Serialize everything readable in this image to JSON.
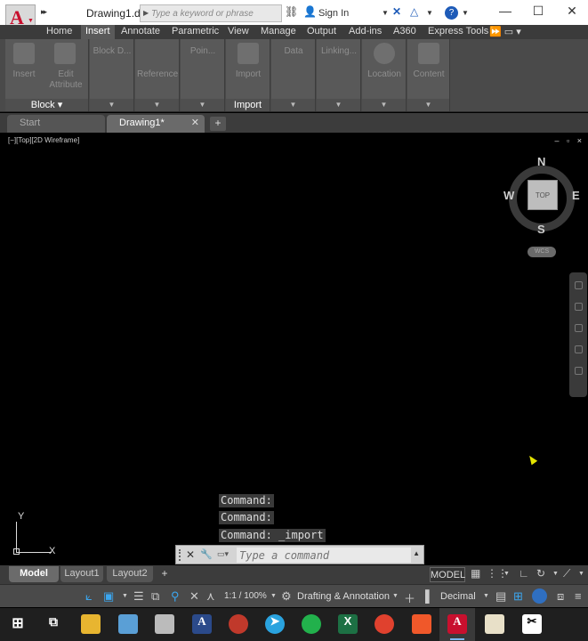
{
  "titlebar": {
    "document_title": "Drawing1.d...",
    "search_placeholder": "Type a keyword or phrase",
    "sign_in": "Sign In",
    "qat_more": "▸▸"
  },
  "ribbon_tabs": [
    {
      "label": "Home"
    },
    {
      "label": "Insert"
    },
    {
      "label": "Annotate"
    },
    {
      "label": "Parametric"
    },
    {
      "label": "View"
    },
    {
      "label": "Manage"
    },
    {
      "label": "Output"
    },
    {
      "label": "Add-ins"
    },
    {
      "label": "A360"
    },
    {
      "label": "Express Tools"
    }
  ],
  "active_tab": "Insert",
  "ribbon_panels": {
    "block": {
      "title": "Block",
      "insert_label": "Insert",
      "edit_attribute_label": "Edit Attribute"
    },
    "block_definition": {
      "label": "Block D..."
    },
    "reference": {
      "label": "Reference"
    },
    "point_cloud": {
      "label": "Poin..."
    },
    "import": {
      "title": "Import",
      "import_label": "Import"
    },
    "data": {
      "label": "Data"
    },
    "linking": {
      "label": "Linking..."
    },
    "location": {
      "label": "Location"
    },
    "content": {
      "label": "Content"
    }
  },
  "file_tabs": {
    "start": "Start",
    "drawing": "Drawing1*",
    "add": "+"
  },
  "viewport": {
    "label": "[−][Top][2D Wireframe]",
    "controls": "– ▫ ×"
  },
  "viewcube": {
    "north": "N",
    "south": "S",
    "east": "E",
    "west": "W",
    "top_face": "TOP",
    "wcs": "WCS"
  },
  "ucs": {
    "x": "X",
    "y": "Y"
  },
  "command_history": [
    "Command:",
    "Command:",
    "Command: _import"
  ],
  "command_line": {
    "placeholder": "Type a command",
    "prompt_icon": "▭▾"
  },
  "layout_tabs": [
    {
      "label": "Model",
      "active": true
    },
    {
      "label": "Layout1"
    },
    {
      "label": "Layout2"
    }
  ],
  "status": {
    "model_button": "MODEL",
    "annotation_scale": "1:1 / 100%",
    "workspace": "Drafting & Annotation",
    "units": "Decimal"
  },
  "colors": {
    "canvas": "#000000",
    "ribbon": "#595959",
    "accent_blue": "#3ba7f0",
    "autocad_red": "#c8102e"
  }
}
